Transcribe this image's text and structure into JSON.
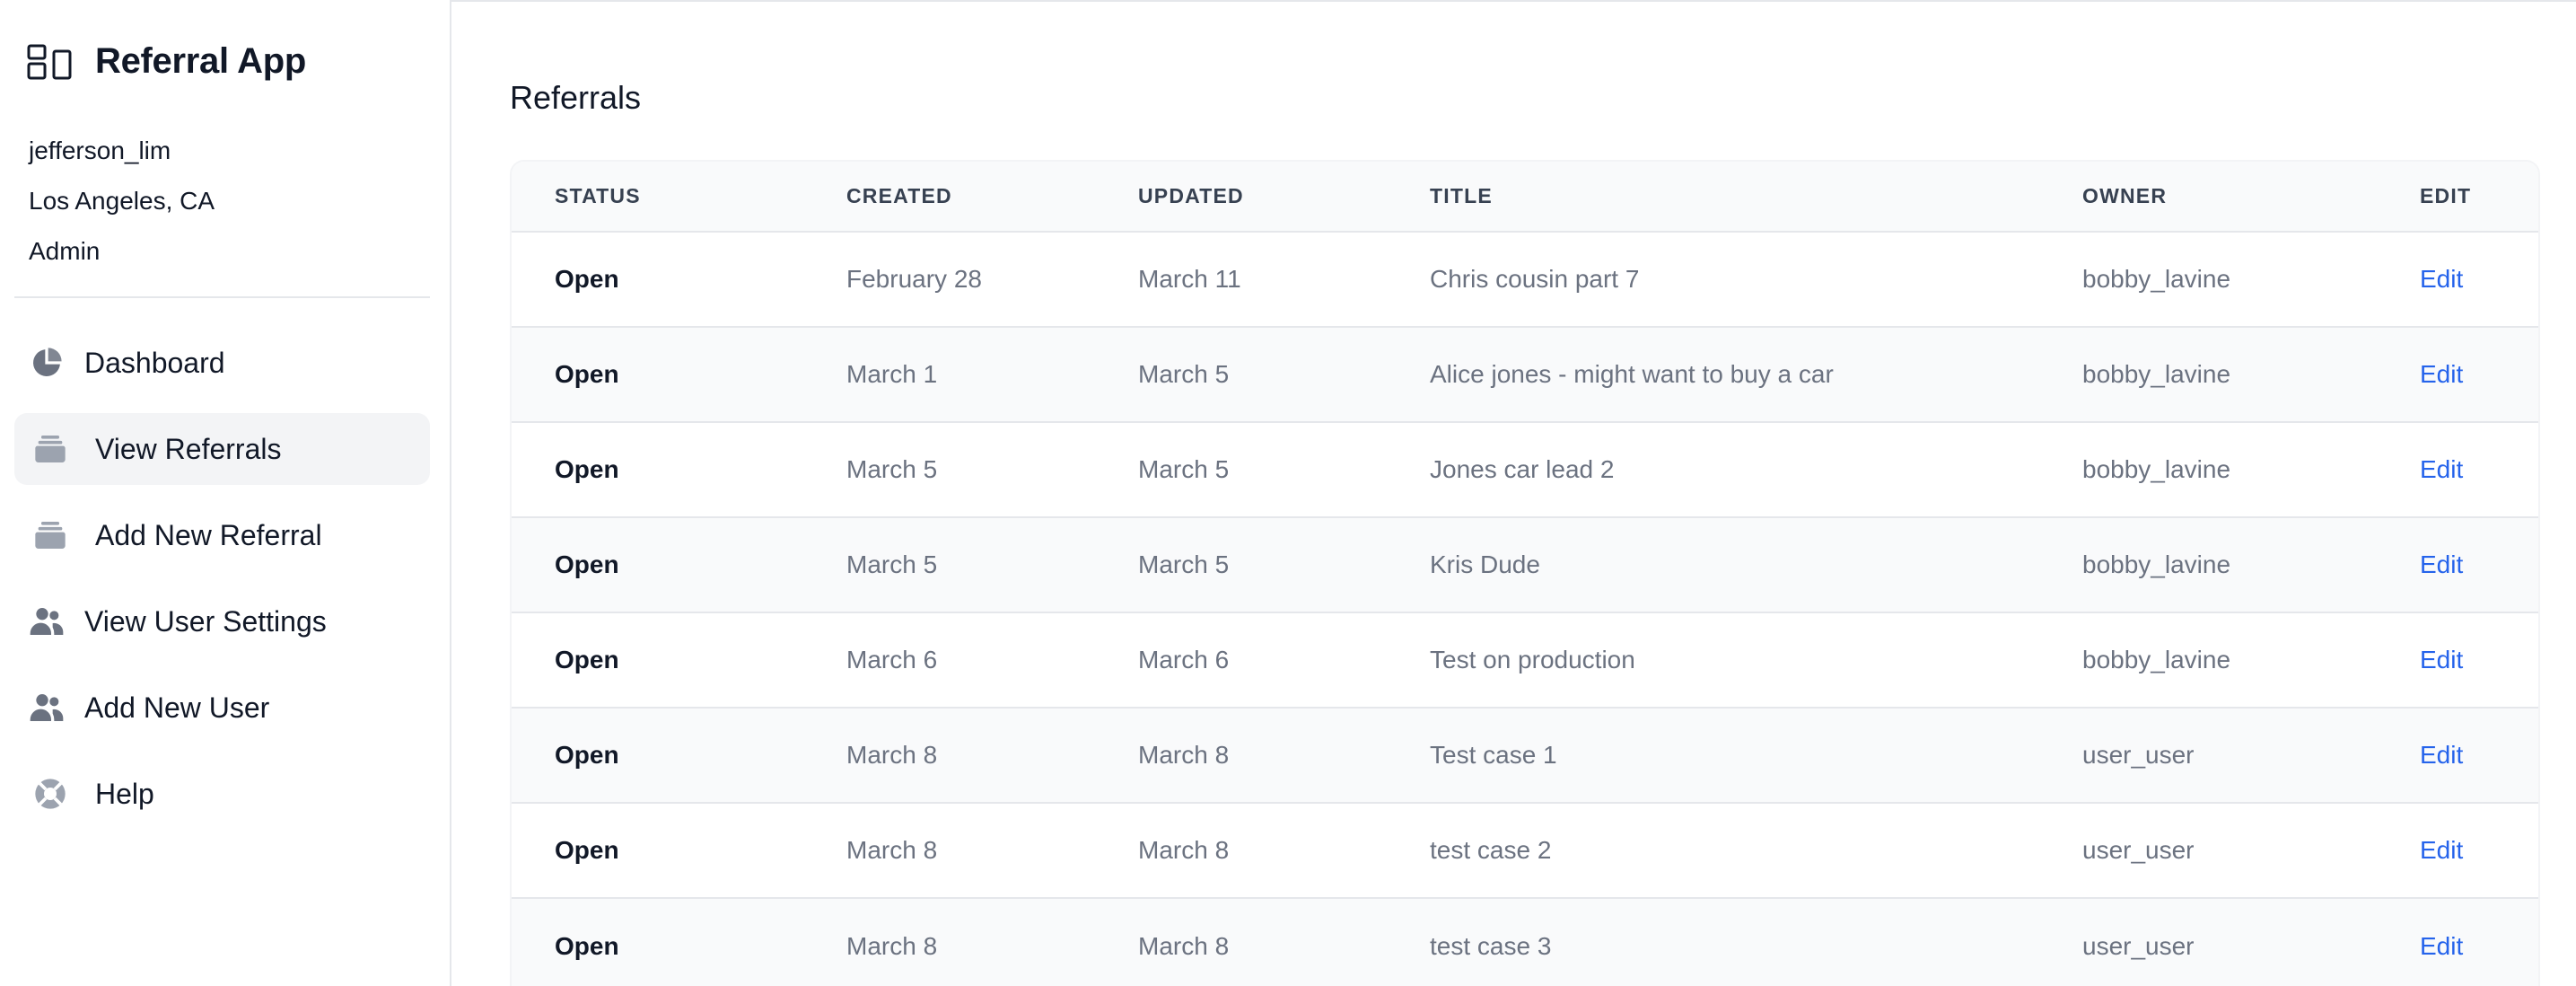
{
  "app": {
    "title": "Referral App",
    "icons": {
      "brand": "layout-icon"
    }
  },
  "user": {
    "username": "jefferson_lim",
    "location": "Los Angeles, CA",
    "role": "Admin"
  },
  "nav": {
    "items": [
      {
        "label": "Dashboard",
        "icon": "pie-chart-icon",
        "active": false
      },
      {
        "label": "View Referrals",
        "icon": "inbox-stack-icon",
        "active": true
      },
      {
        "label": "Add New Referral",
        "icon": "inbox-stack-icon",
        "active": false
      },
      {
        "label": "View User Settings",
        "icon": "users-icon",
        "active": false
      },
      {
        "label": "Add New User",
        "icon": "users-icon",
        "active": false
      },
      {
        "label": "Help",
        "icon": "lifebuoy-icon",
        "active": false
      }
    ]
  },
  "page": {
    "title": "Referrals"
  },
  "table": {
    "headers": {
      "status": "Status",
      "created": "Created",
      "updated": "Updated",
      "title": "Title",
      "owner": "Owner",
      "edit": "Edit"
    },
    "rows": [
      {
        "status": "Open",
        "created": "February 28",
        "updated": "March 11",
        "title": "Chris cousin part 7",
        "owner": "bobby_lavine",
        "edit": "Edit"
      },
      {
        "status": "Open",
        "created": "March 1",
        "updated": "March 5",
        "title": "Alice jones - might want to buy a car",
        "owner": "bobby_lavine",
        "edit": "Edit"
      },
      {
        "status": "Open",
        "created": "March 5",
        "updated": "March 5",
        "title": "Jones car lead 2",
        "owner": "bobby_lavine",
        "edit": "Edit"
      },
      {
        "status": "Open",
        "created": "March 5",
        "updated": "March 5",
        "title": "Kris Dude",
        "owner": "bobby_lavine",
        "edit": "Edit"
      },
      {
        "status": "Open",
        "created": "March 6",
        "updated": "March 6",
        "title": "Test on production",
        "owner": "bobby_lavine",
        "edit": "Edit"
      },
      {
        "status": "Open",
        "created": "March 8",
        "updated": "March 8",
        "title": "Test case 1",
        "owner": "user_user",
        "edit": "Edit"
      },
      {
        "status": "Open",
        "created": "March 8",
        "updated": "March 8",
        "title": "test case 2",
        "owner": "user_user",
        "edit": "Edit"
      },
      {
        "status": "Open",
        "created": "March 8",
        "updated": "March 8",
        "title": "test case 3",
        "owner": "user_user",
        "edit": "Edit"
      }
    ]
  },
  "colors": {
    "accent_link": "#2563eb",
    "text_primary": "#111827",
    "text_muted": "#6b7280",
    "active_nav_bg": "#f3f4f6",
    "icon_gray": "#6b7280"
  }
}
